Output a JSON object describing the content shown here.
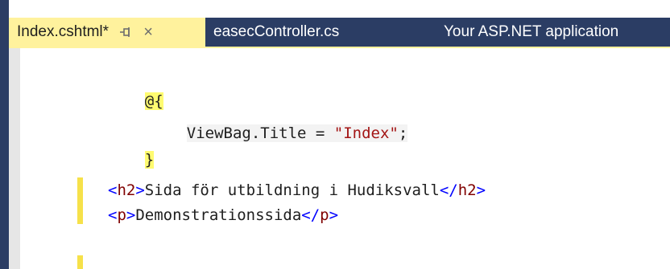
{
  "tabs": [
    {
      "label": "Index.cshtml*",
      "active": true,
      "pin_icon": "pin-icon",
      "close_icon": "close-icon",
      "close_glyph": "×"
    },
    {
      "label": "easecController.cs",
      "active": false
    },
    {
      "label": "Your ASP.NET application",
      "active": false
    }
  ],
  "code": {
    "line1": {
      "razor_open": "@{"
    },
    "line2": {
      "text": "ViewBag.Title = ",
      "string": "\"Index\"",
      "end": ";"
    },
    "line3": {
      "razor_close": "}"
    },
    "line4": {
      "lt1": "<",
      "tag1": "h2",
      "gt1": ">",
      "text": "Sida för utbildning i Hudiksvall",
      "lt2": "</",
      "tag2": "h2",
      "gt2": ">"
    },
    "line5": {
      "lt1": "<",
      "tag1": "p",
      "gt1": ">",
      "text": "Demonstrationssida",
      "lt2": "</",
      "tag2": "p",
      "gt2": ">"
    }
  },
  "colors": {
    "frame": "#2b3d64",
    "active_tab": "#fff29d",
    "razor_highlight": "#fffb70",
    "change_marker": "#f6e14a",
    "html_tag": "#800000",
    "html_bracket": "#0000ff",
    "string": "#a31515"
  }
}
